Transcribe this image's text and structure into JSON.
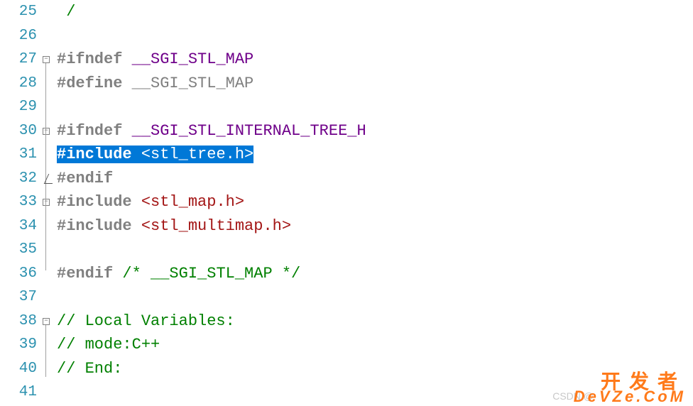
{
  "colors": {
    "comment": "#008000",
    "preprocessor": "#808080",
    "macro": "#6f008a",
    "string_bracket": "#a31515",
    "selection_bg": "#0078d7",
    "line_number": "#2b91af"
  },
  "lines": [
    {
      "num": 25,
      "tokens": [
        {
          "t": "comment",
          "v": " /"
        }
      ],
      "fold": null
    },
    {
      "num": 26,
      "tokens": [],
      "fold": null
    },
    {
      "num": 27,
      "tokens": [
        {
          "t": "preproc",
          "v": "#ifndef"
        },
        {
          "t": "plain",
          "v": " "
        },
        {
          "t": "macro",
          "v": "__SGI_STL_MAP"
        }
      ],
      "fold": "open"
    },
    {
      "num": 28,
      "tokens": [
        {
          "t": "preproc",
          "v": "#define"
        },
        {
          "t": "plain",
          "v": " "
        },
        {
          "t": "define",
          "v": "__SGI_STL_MAP"
        }
      ],
      "fold": null
    },
    {
      "num": 29,
      "tokens": [],
      "fold": null
    },
    {
      "num": 30,
      "tokens": [
        {
          "t": "preproc",
          "v": "#ifndef"
        },
        {
          "t": "plain",
          "v": " "
        },
        {
          "t": "macro",
          "v": "__SGI_STL_INTERNAL_TREE_H"
        }
      ],
      "fold": "open"
    },
    {
      "num": 31,
      "tokens": [
        {
          "t": "preproc",
          "v": "#include",
          "sel": true
        },
        {
          "t": "plain",
          "v": " ",
          "sel": true
        },
        {
          "t": "bracket",
          "v": "<stl_tree.h>",
          "sel": true
        }
      ],
      "fold": null,
      "selected": true
    },
    {
      "num": 32,
      "tokens": [
        {
          "t": "preproc",
          "v": "#endif"
        }
      ],
      "fold": null,
      "cursor": true
    },
    {
      "num": 33,
      "tokens": [
        {
          "t": "preproc",
          "v": "#include"
        },
        {
          "t": "plain",
          "v": " "
        },
        {
          "t": "bracket",
          "v": "<stl_map.h>"
        }
      ],
      "fold": "open"
    },
    {
      "num": 34,
      "tokens": [
        {
          "t": "preproc",
          "v": "#include"
        },
        {
          "t": "plain",
          "v": " "
        },
        {
          "t": "bracket",
          "v": "<stl_multimap.h>"
        }
      ],
      "fold": null
    },
    {
      "num": 35,
      "tokens": [],
      "fold": null
    },
    {
      "num": 36,
      "tokens": [
        {
          "t": "preproc",
          "v": "#endif"
        },
        {
          "t": "plain",
          "v": " "
        },
        {
          "t": "comment",
          "v": "/* __SGI_STL_MAP */"
        }
      ],
      "fold": null
    },
    {
      "num": 37,
      "tokens": [],
      "fold": null
    },
    {
      "num": 38,
      "tokens": [
        {
          "t": "comment",
          "v": "// Local Variables:"
        }
      ],
      "fold": "open"
    },
    {
      "num": 39,
      "tokens": [
        {
          "t": "comment",
          "v": "// mode:C++"
        }
      ],
      "fold": null
    },
    {
      "num": 40,
      "tokens": [
        {
          "t": "comment",
          "v": "// End:"
        }
      ],
      "fold": null
    },
    {
      "num": 41,
      "tokens": [],
      "fold": null
    }
  ],
  "watermark": {
    "cn": "开发者",
    "en": "DeVZe.CoM",
    "csdn": "CSDN @"
  }
}
